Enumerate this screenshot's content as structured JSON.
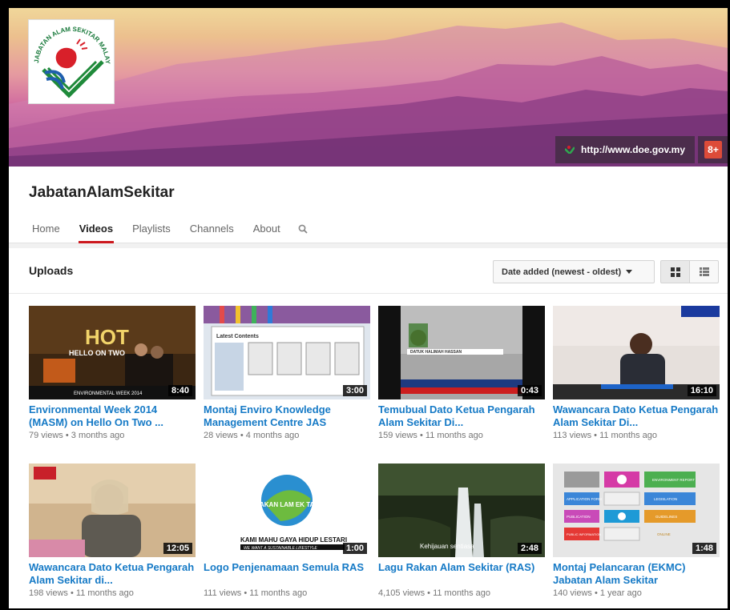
{
  "banner": {
    "website": "http://www.doe.gov.my",
    "gplus": "8+",
    "logo_text": "JABATAN ALAM SEKITAR MALAYSIA"
  },
  "channel": {
    "title": "JabatanAlamSekitar"
  },
  "tabs": [
    {
      "label": "Home",
      "active": false
    },
    {
      "label": "Videos",
      "active": true
    },
    {
      "label": "Playlists",
      "active": false
    },
    {
      "label": "Channels",
      "active": false
    },
    {
      "label": "About",
      "active": false
    }
  ],
  "section": {
    "title": "Uploads",
    "sort_label": "Date added (newest - oldest)",
    "view_mode": "grid"
  },
  "videos": [
    {
      "title": "Environmental Week 2014 (MASM) on Hello On Two ...",
      "duration": "8:40",
      "views": "79 views",
      "age": "3 months ago",
      "thumb_color": "#3a2a1a"
    },
    {
      "title": "Montaj Enviro Knowledge Management Centre JAS",
      "duration": "3:00",
      "views": "28 views",
      "age": "4 months ago",
      "thumb_color": "#dfe6ee"
    },
    {
      "title": "Temubual Dato Ketua Pengarah Alam Sekitar Di...",
      "duration": "0:43",
      "views": "159 views",
      "age": "11 months ago",
      "thumb_color": "#9a9a9a"
    },
    {
      "title": "Wawancara Dato Ketua Pengarah Alam Sekitar Di...",
      "duration": "16:10",
      "views": "113 views",
      "age": "11 months ago",
      "thumb_color": "#d9d3cf"
    },
    {
      "title": "Wawancara Dato Ketua Pengarah Alam Sekitar di...",
      "duration": "12:05",
      "views": "198 views",
      "age": "11 months ago",
      "thumb_color": "#c9b08e"
    },
    {
      "title": "Logo Penjenamaan Semula RAS",
      "duration": "1:00",
      "views": "111 views",
      "age": "11 months ago",
      "thumb_color": "#ffffff"
    },
    {
      "title": "Lagu Rakan Alam Sekitar (RAS)",
      "duration": "2:48",
      "views": "4,105 views",
      "age": "11 months ago",
      "thumb_color": "#2f3a22"
    },
    {
      "title": "Montaj Pelancaran (EKMC) Jabatan Alam Sekitar",
      "duration": "1:48",
      "views": "140 views",
      "age": "1 year ago",
      "thumb_color": "#e8e8e8"
    }
  ],
  "thumb_captions": {
    "v0_top": "HOT",
    "v0_mid": "HELLO ON TWO",
    "v0_bottom": "ENVIRONMENTAL WEEK 2014",
    "v1_header": "Latest Contents",
    "v2_name": "DATUK HALIMAH HASSAN",
    "v5_top": "AKAN LAM EK TAR",
    "v5_slogan": "KAMI MAHU GAYA HIDUP LESTARI",
    "v5_sub": "WE WANT A SUSTAINABLE LIFESTYLE",
    "v6_caption": "Kehijauan sentiasa",
    "v7_form": "APPLICATION FORM",
    "v7_report": "ENVIRONMENT REPORT",
    "v7_pub": "PUBLICATION",
    "v7_leg": "LEGISLATION",
    "v7_guide": "GUIDELINES",
    "v7_info": "PUBLIC INFORMATION",
    "v7_status": "ONLINE"
  },
  "colors": {
    "link": "#167ac6",
    "accent_red": "#cc181e",
    "meta_gray": "#767676"
  }
}
